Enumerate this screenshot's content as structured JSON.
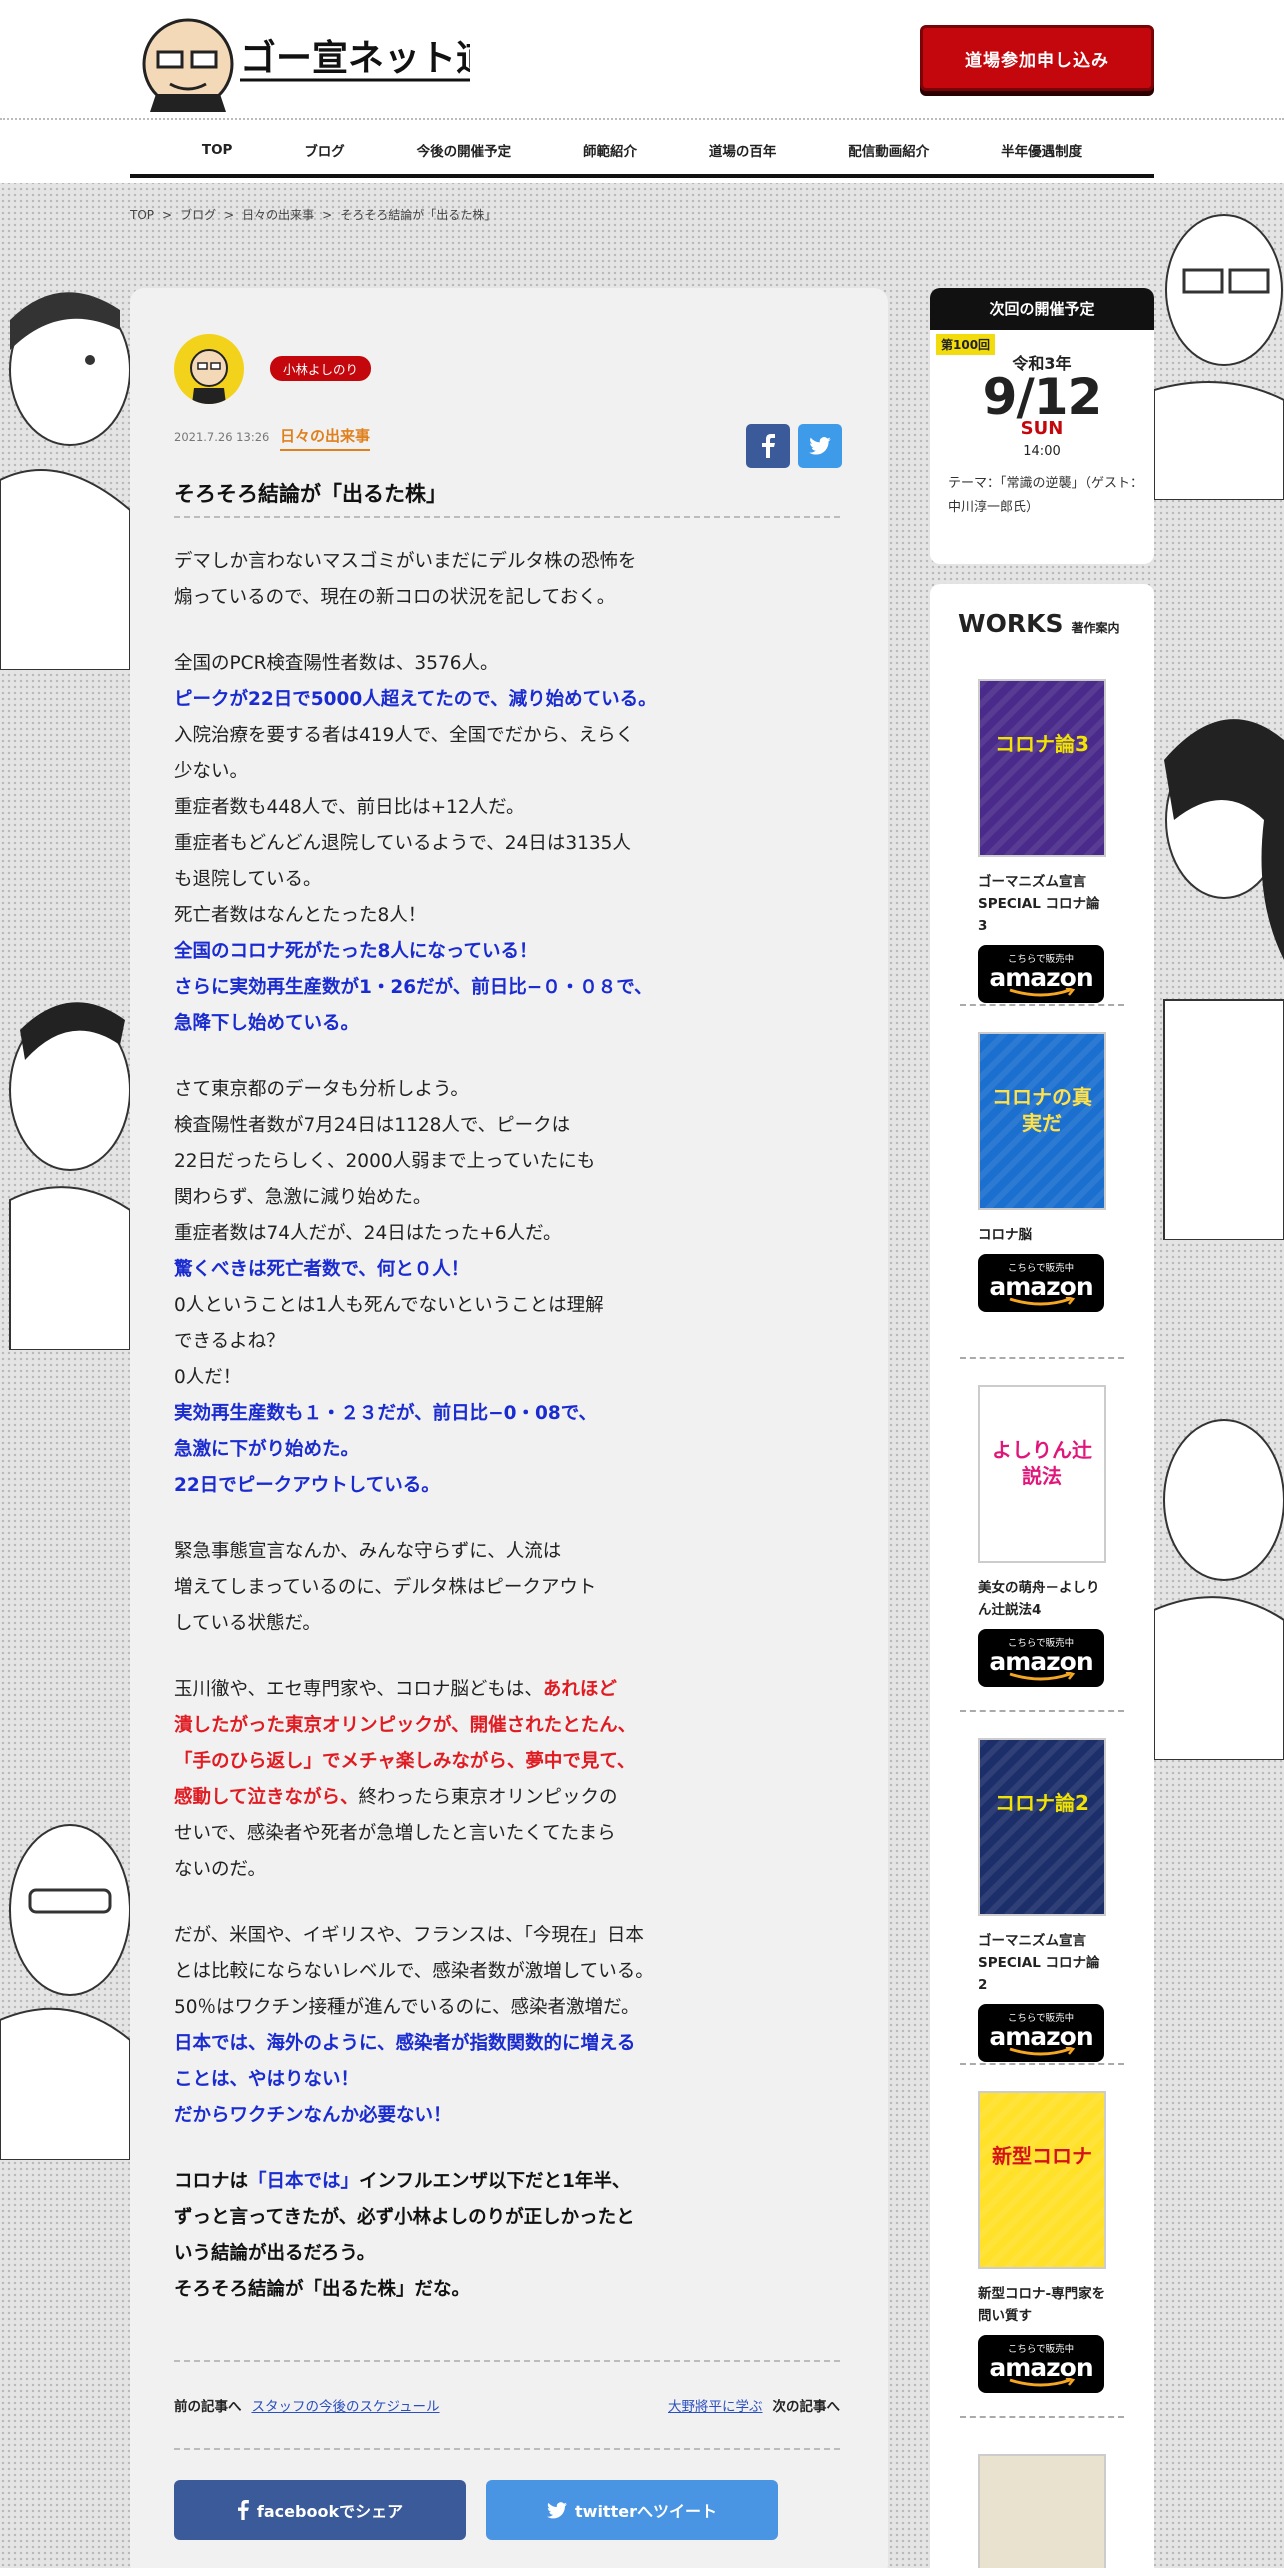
{
  "header": {
    "logo_alt": "ゴー宣ネット道場",
    "cta_label": "道場参加申し込み"
  },
  "nav": [
    "TOP",
    "ブログ",
    "今後の開催予定",
    "師範紹介",
    "道場の百年",
    "配信動画紹介",
    "半年優遇制度"
  ],
  "breadcrumb": [
    "TOP",
    ">",
    "ブログ",
    ">",
    "日々の出来事",
    ">",
    "そろそろ結論が「出るた株」"
  ],
  "article": {
    "author": "小林よしのり",
    "date": "2021.7.26 13:26",
    "category": "日々の出来事",
    "title": "そろそろ結論が「出るた株」",
    "paragraphs": [
      [
        [
          {
            "t": "デマしか言わないマスゴミがいまだにデルタ株の恐怖を",
            "c": ""
          }
        ],
        [
          {
            "t": "煽っているので、現在の新コロの状況を記しておく。",
            "c": ""
          }
        ]
      ],
      [
        [
          {
            "t": "全国のPCR検査陽性者数は、3576人。",
            "c": ""
          }
        ],
        [
          {
            "t": "ピークが22日で5000人超えてたので、減り始めている。",
            "c": "blue"
          }
        ],
        [
          {
            "t": "入院治療を要する者は419人で、全国でだから、えらく",
            "c": ""
          }
        ],
        [
          {
            "t": "少ない。",
            "c": ""
          }
        ],
        [
          {
            "t": "重症者数も448人で、前日比は+12人だ。",
            "c": ""
          }
        ],
        [
          {
            "t": "重症者もどんどん退院しているようで、24日は3135人",
            "c": ""
          }
        ],
        [
          {
            "t": "も退院している。",
            "c": ""
          }
        ],
        [
          {
            "t": "死亡者数はなんとたった8人！",
            "c": ""
          }
        ],
        [
          {
            "t": "全国のコロナ死がたった8人になっている！",
            "c": "blue"
          }
        ],
        [
          {
            "t": "さらに実効再生産数が1・26だが、前日比−０・０８で、",
            "c": "blue"
          }
        ],
        [
          {
            "t": "急降下し始めている。",
            "c": "blue"
          }
        ]
      ],
      [
        [
          {
            "t": "さて東京都のデータも分析しよう。",
            "c": ""
          }
        ],
        [
          {
            "t": "検査陽性者数が7月24日は1128人で、ピークは",
            "c": ""
          }
        ],
        [
          {
            "t": "22日だったらしく、2000人弱まで上っていたにも",
            "c": ""
          }
        ],
        [
          {
            "t": "関わらず、急激に減り始めた。",
            "c": ""
          }
        ],
        [
          {
            "t": "重症者数は74人だが、24日はたった+6人だ。",
            "c": ""
          }
        ],
        [
          {
            "t": "驚くべきは死亡者数で、何と０人！",
            "c": "blue"
          }
        ],
        [
          {
            "t": "0人ということは1人も死んでないということは理解",
            "c": ""
          }
        ],
        [
          {
            "t": "できるよね？",
            "c": ""
          }
        ],
        [
          {
            "t": "0人だ！",
            "c": ""
          }
        ],
        [
          {
            "t": "実効再生産数も１・２３だが、前日比−0・08で、",
            "c": "blue"
          }
        ],
        [
          {
            "t": "急激に下がり始めた。",
            "c": "blue"
          }
        ],
        [
          {
            "t": "22日でピークアウトしている。",
            "c": "blue"
          }
        ]
      ],
      [
        [
          {
            "t": "緊急事態宣言なんか、みんな守らずに、人流は",
            "c": ""
          }
        ],
        [
          {
            "t": "増えてしまっているのに、デルタ株はピークアウト",
            "c": ""
          }
        ],
        [
          {
            "t": "している状態だ。",
            "c": ""
          }
        ]
      ],
      [
        [
          {
            "t": "玉川徹や、エセ専門家や、コロナ脳どもは、",
            "c": ""
          },
          {
            "t": "あれほど",
            "c": "red"
          }
        ],
        [
          {
            "t": "潰したがった東京オリンピックが、開催されたとたん、",
            "c": "red"
          }
        ],
        [
          {
            "t": "「手のひら返し」でメチャ楽しみながら、夢中で見て、",
            "c": "red"
          }
        ],
        [
          {
            "t": "感動して泣きながら、",
            "c": "red"
          },
          {
            "t": "終わったら東京オリンピックの",
            "c": ""
          }
        ],
        [
          {
            "t": "せいで、感染者や死者が急増したと言いたくてたまら",
            "c": ""
          }
        ],
        [
          {
            "t": "ないのだ。",
            "c": ""
          }
        ]
      ],
      [
        [
          {
            "t": "だが、米国や、イギリスや、フランスは、「今現在」日本",
            "c": ""
          }
        ],
        [
          {
            "t": "とは比較にならないレベルで、感染者数が激増している。",
            "c": ""
          }
        ],
        [
          {
            "t": "50％はワクチン接種が進んでいるのに、感染者激増だ。",
            "c": ""
          }
        ],
        [
          {
            "t": "日本では、海外のように、感染者が指数関数的に増える",
            "c": "blue"
          }
        ],
        [
          {
            "t": "ことは、やはりない！",
            "c": "blue"
          }
        ],
        [
          {
            "t": "だからワクチンなんか必要ない！",
            "c": "blue"
          }
        ]
      ],
      [
        [
          {
            "t": "コロナは",
            "c": "strong"
          },
          {
            "t": "「日本では」",
            "c": "blue"
          },
          {
            "t": "インフルエンザ以下だと1年半、",
            "c": "strong"
          }
        ],
        [
          {
            "t": "ずっと言ってきたが、必ず小林よしのりが正しかったと",
            "c": "strong"
          }
        ],
        [
          {
            "t": "いう結論が出るだろう。",
            "c": "strong"
          }
        ],
        [
          {
            "t": "そろそろ結論が「出るた株」だな。",
            "c": "strong"
          }
        ]
      ]
    ],
    "prev_label": "前の記事へ",
    "prev_link": "スタッフの今後のスケジュール",
    "next_link": "大野將平に学ぶ",
    "next_label": "次の記事へ",
    "share_facebook": "facebookでシェア",
    "share_twitter": "twitterへツイート"
  },
  "schedule": {
    "heading": "次回の開催予定",
    "number": "第100回",
    "era": "令和3年",
    "date": "9/12",
    "day": "SUN",
    "time": "14:00",
    "theme": "テーマ：「常識の逆襲」（ゲスト：中川淳一郎氏）"
  },
  "works": {
    "heading": "WORKS",
    "subheading": "著作案内",
    "amazon_small": "こちらで販売中",
    "amazon_big": "amazon",
    "books": [
      {
        "title": "ゴーマニズム宣言SPECIAL コロナ論3",
        "cover": "コロナ論3"
      },
      {
        "title": "コロナ脳",
        "cover": "コロナの真実だ"
      },
      {
        "title": "美女の萌舟－よしりん辻説法4",
        "cover": "よしりん辻説法"
      },
      {
        "title": "ゴーマニズム宣言SPECIAL コロナ論2",
        "cover": "コロナ論2"
      },
      {
        "title": "新型コロナ-専門家を問い質す",
        "cover": "新型コロナ"
      }
    ]
  },
  "colors": {
    "brand_red": "#c4070d",
    "emph_blue": "#1a2bd0",
    "emph_red": "#e01b22",
    "category_orange": "#e0801d"
  }
}
